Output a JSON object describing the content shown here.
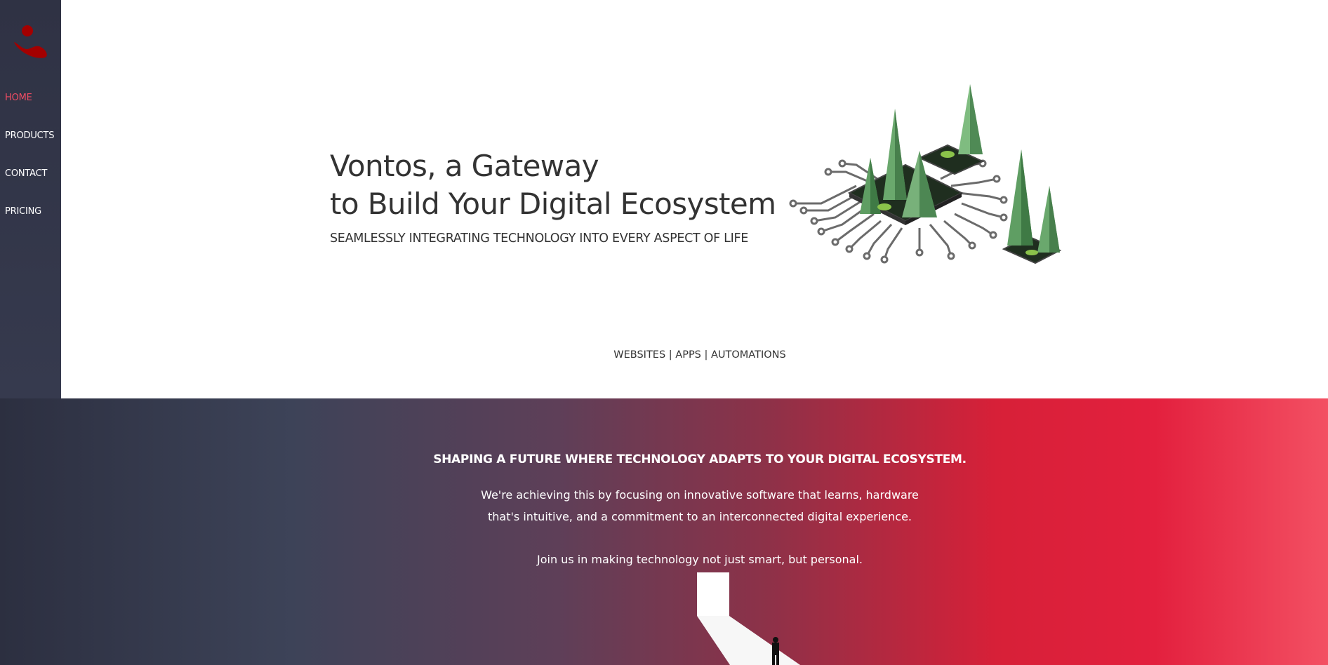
{
  "sidebar": {
    "logo_icon": "brand-logo-icon",
    "items": [
      {
        "label": "HOME",
        "active": true
      },
      {
        "label": "PRODUCTS",
        "active": false
      },
      {
        "label": "CONTACT",
        "active": false
      },
      {
        "label": "PRICING",
        "active": false
      }
    ]
  },
  "hero": {
    "title_line1": "Vontos, a Gateway",
    "title_line2": "to Build Your Digital Ecosystem",
    "subtitle": "SEAMLESSLY INTEGRATING TECHNOLOGY INTO EVERY ASPECT OF LIFE",
    "services": "WEBSITES | APPS | AUTOMATIONS",
    "illustration_icon": "circuit-forest-illustration"
  },
  "mission": {
    "heading": "SHAPING A FUTURE WHERE TECHNOLOGY ADAPTS TO YOUR DIGITAL ECOSYSTEM.",
    "line1": "We're achieving this by focusing on innovative software that learns, hardware",
    "line2": "that's intuitive, and a commitment to an interconnected digital experience.",
    "line3": "Join us in making technology not just smart, but personal.",
    "illustration_icon": "door-person-illustration"
  },
  "colors": {
    "sidebar_bg": "#2f3244",
    "accent": "#ef4c63",
    "brand_red": "#b00000",
    "text_dark": "#333333"
  }
}
